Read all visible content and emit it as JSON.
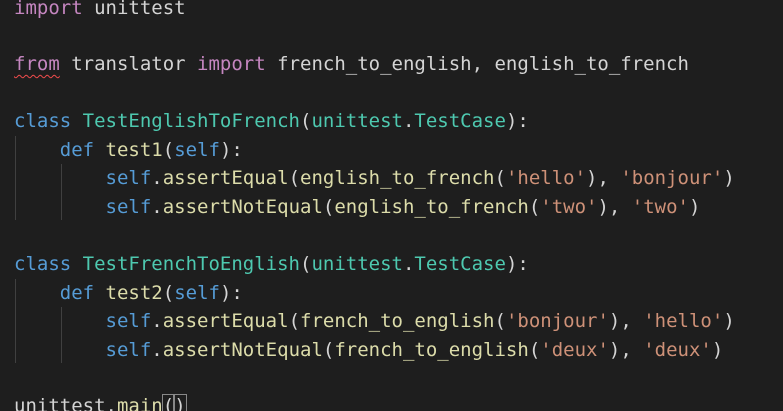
{
  "colors": {
    "background": "#1e1e1e",
    "keyword_import": "#c586c0",
    "keyword_def": "#569cd6",
    "class_name": "#4ec9b0",
    "function": "#dcdcaa",
    "string": "#ce9178",
    "text": "#d4d4d4",
    "error_squiggle": "#f14c4c"
  },
  "code": {
    "l1": {
      "kw": "import",
      "mod": " unittest"
    },
    "l3": {
      "kw": "from",
      "mod": " translator ",
      "kw2": "import",
      "names": " french_to_english, english_to_french"
    },
    "l5": {
      "kw": "class",
      "name": "TestEnglishToFrench",
      "p1": "(",
      "base1": "unittest",
      "dot": ".",
      "base2": "TestCase",
      "p2": "):"
    },
    "l6": {
      "kw": "def",
      "name": "test1",
      "p1": "(",
      "self": "self",
      "p2": "):"
    },
    "l7": {
      "self": "self",
      "dot": ".",
      "method": "assertEqual",
      "p1": "(",
      "fn": "english_to_french",
      "p2": "(",
      "s1": "'hello'",
      "p3": "), ",
      "s2": "'bonjour'",
      "p4": ")"
    },
    "l8": {
      "self": "self",
      "dot": ".",
      "method": "assertNotEqual",
      "p1": "(",
      "fn": "english_to_french",
      "p2": "(",
      "s1": "'two'",
      "p3": "), ",
      "s2": "'two'",
      "p4": ")"
    },
    "l10": {
      "kw": "class",
      "name": "TestFrenchToEnglish",
      "p1": "(",
      "base1": "unittest",
      "dot": ".",
      "base2": "TestCase",
      "p2": "):"
    },
    "l11": {
      "kw": "def",
      "name": "test2",
      "p1": "(",
      "self": "self",
      "p2": "):"
    },
    "l12": {
      "self": "self",
      "dot": ".",
      "method": "assertEqual",
      "p1": "(",
      "fn": "french_to_english",
      "p2": "(",
      "s1": "'bonjour'",
      "p3": "), ",
      "s2": "'hello'",
      "p4": ")"
    },
    "l13": {
      "self": "self",
      "dot": ".",
      "method": "assertNotEqual",
      "p1": "(",
      "fn": "french_to_english",
      "p2": "(",
      "s1": "'deux'",
      "p3": "), ",
      "s2": "'deux'",
      "p4": ")"
    },
    "l15": {
      "obj": "unittest",
      "dot": ".",
      "fn": "main",
      "po": "(",
      "pc": ")"
    }
  }
}
